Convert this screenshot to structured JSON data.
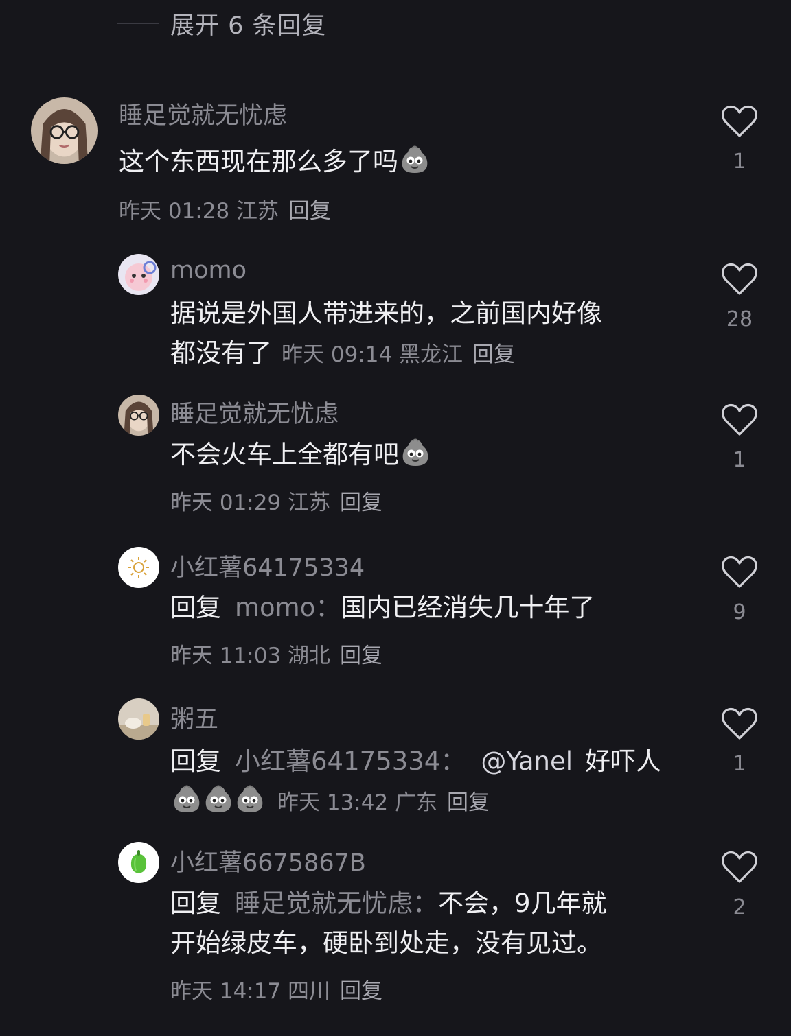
{
  "expand": {
    "label": "展开 6 条回复"
  },
  "comments": [
    {
      "user": "睡足觉就无忧虑",
      "text": "这个东西现在那么多了吗",
      "meta": "昨天 01:28 江苏",
      "reply": "回复",
      "likes": "1",
      "avatar_icon": "glasses-girl-avatar",
      "emoji": "grimace-emoji"
    },
    {
      "user": "momo",
      "text_line1": "据说是外国人带进来的，之前国内好像",
      "text_line2": "都没有了",
      "meta": "昨天 09:14 黑龙江",
      "reply": "回复",
      "likes": "28",
      "avatar_icon": "cartoon-pink-avatar"
    },
    {
      "user": "睡足觉就无忧虑",
      "text": "不会火车上全都有吧",
      "meta": "昨天 01:29 江苏",
      "reply": "回复",
      "likes": "1",
      "avatar_icon": "glasses-girl-avatar",
      "emoji": "grimace-emoji"
    },
    {
      "user": "小红薯64175334",
      "reply_prefix": "回复",
      "reply_target": "momo",
      "colon": "：",
      "text": "国内已经消失几十年了",
      "meta": "昨天 11:03 湖北",
      "reply": "回复",
      "likes": "9",
      "avatar_icon": "sun-avatar"
    },
    {
      "user": "粥五",
      "reply_prefix": "回复",
      "reply_target": "小红薯64175334",
      "colon": "：",
      "mention": "@Yanel",
      "text": "好吓人",
      "meta": "昨天 13:42 广东",
      "reply": "回复",
      "likes": "1",
      "avatar_icon": "photo-avatar",
      "emoji": "grimace-emoji"
    },
    {
      "user": "小红薯6675867B",
      "reply_prefix": "回复",
      "reply_target": "睡足觉就无忧虑",
      "colon": "：",
      "text_line1": "不会，9几年就",
      "text_line2": "开始绿皮车，硬卧到处走，没有见过。",
      "meta": "昨天 14:17 四川",
      "reply": "回复",
      "likes": "2",
      "avatar_icon": "pepper-avatar"
    }
  ],
  "colors": {
    "background": "#16161b",
    "primary_text": "#efeff2",
    "secondary_text": "#8b8b93",
    "like_icon": "#d0d0d6"
  }
}
